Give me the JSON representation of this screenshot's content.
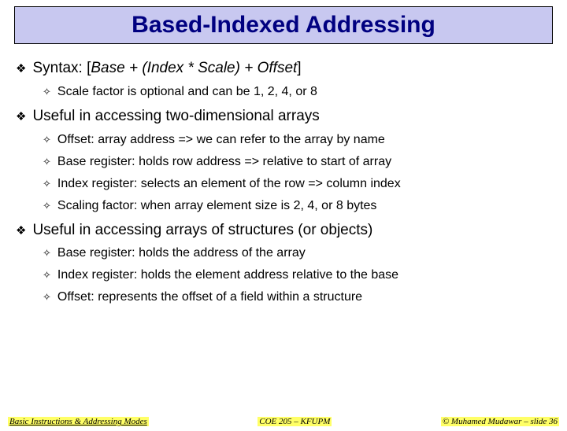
{
  "title": "Based-Indexed Addressing",
  "bullets": [
    {
      "level": 1,
      "prefix": "Syntax: [",
      "em": "Base + (Index * Scale) + Offset",
      "suffix": "]",
      "children": [
        "Scale factor is optional and can be 1, 2, 4, or 8"
      ]
    },
    {
      "level": 1,
      "text": "Useful in accessing two-dimensional arrays",
      "children": [
        "Offset: array address => we can refer to the array by name",
        "Base register: holds row address => relative to start of array",
        "Index register: selects an element of the row => column index",
        "Scaling factor: when array element size is 2, 4, or 8 bytes"
      ]
    },
    {
      "level": 1,
      "text": "Useful in accessing arrays of structures (or objects)",
      "children": [
        "Base register: holds the address of the array",
        "Index register: holds the element address relative to the base",
        "Offset: represents the offset of a field within a structure"
      ]
    }
  ],
  "footer": {
    "left": "Basic Instructions & Addressing Modes",
    "center": "COE 205 – KFUPM",
    "right": "© Muhamed Mudawar – slide 36"
  },
  "glyphs": {
    "diamond": "❖",
    "cross": "✧"
  }
}
